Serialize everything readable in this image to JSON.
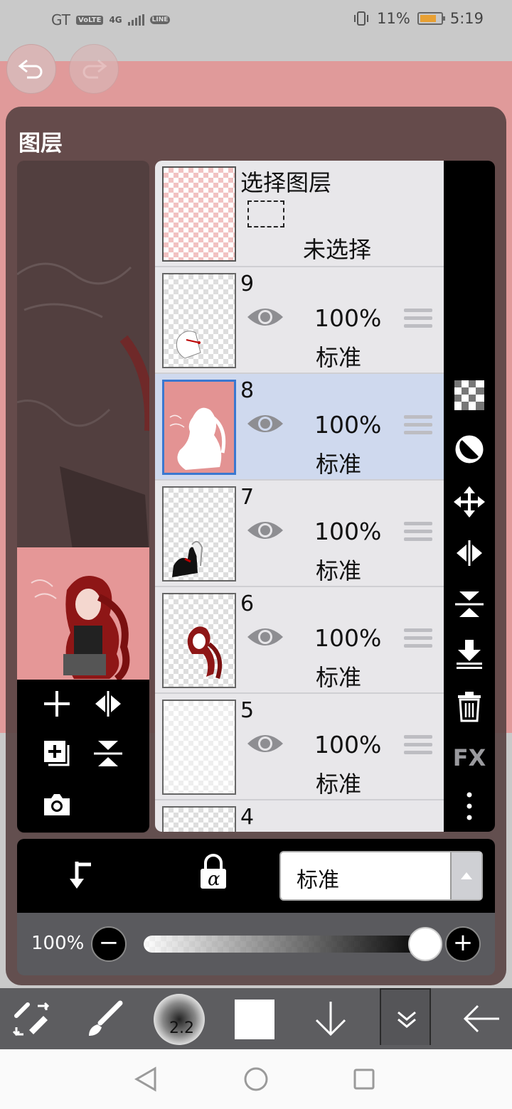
{
  "status_bar": {
    "carrier": "GT",
    "volte": "VoLTE",
    "network": "4G",
    "line_badge": "LINE",
    "battery_pct": "11%",
    "time": "5:19"
  },
  "panel": {
    "title": "图层"
  },
  "selection_layer": {
    "title": "选择图层",
    "status": "未选择"
  },
  "layers": [
    {
      "number": "9",
      "opacity": "100%",
      "mode": "标准",
      "selected": false
    },
    {
      "number": "8",
      "opacity": "100%",
      "mode": "标准",
      "selected": true
    },
    {
      "number": "7",
      "opacity": "100%",
      "mode": "标准",
      "selected": false
    },
    {
      "number": "6",
      "opacity": "100%",
      "mode": "标准",
      "selected": false
    },
    {
      "number": "5",
      "opacity": "100%",
      "mode": "标准",
      "selected": false
    },
    {
      "number": "4"
    }
  ],
  "right_toolbar": {
    "fx_label": "FX"
  },
  "blend": {
    "mode_value": "标准",
    "alpha_symbol": "α"
  },
  "opacity": {
    "label": "100%",
    "value": 1.0
  },
  "bottom_toolbar": {
    "brush_size": "2.2"
  },
  "colors": {
    "canvas_bg": "#e09a9a",
    "panel_bg": "#5a4444",
    "selected_row": "#cfd9ee",
    "selected_border": "#3a78d0"
  }
}
